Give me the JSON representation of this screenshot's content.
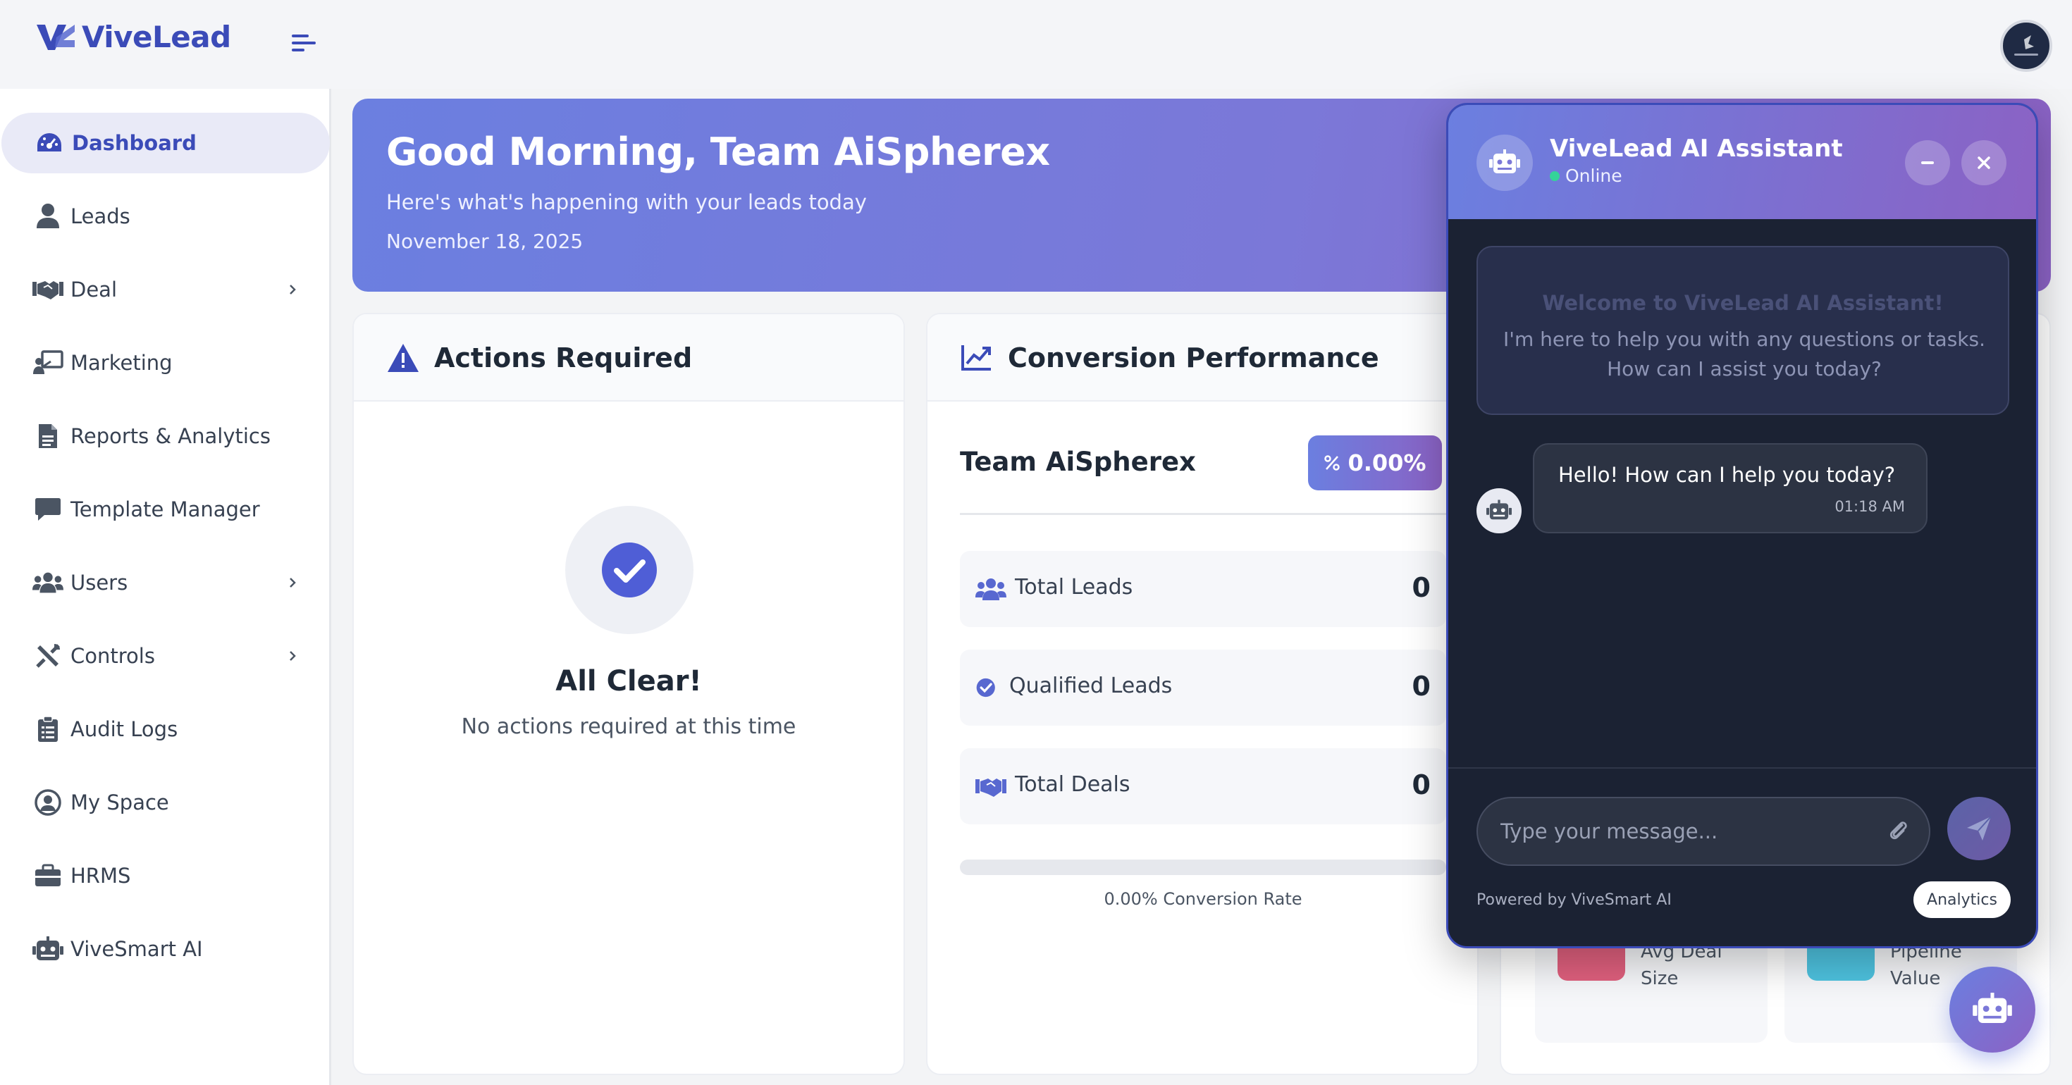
{
  "app": {
    "brand": "ViveLead"
  },
  "sidebar": {
    "items": [
      {
        "label": "Dashboard",
        "icon": "gauge-icon",
        "active": true
      },
      {
        "label": "Leads",
        "icon": "user-icon"
      },
      {
        "label": "Deal",
        "icon": "handshake-icon",
        "has_submenu": true
      },
      {
        "label": "Marketing",
        "icon": "presentation-icon"
      },
      {
        "label": "Reports & Analytics",
        "icon": "file-chart-icon"
      },
      {
        "label": "Template Manager",
        "icon": "message-icon"
      },
      {
        "label": "Users",
        "icon": "users-icon",
        "has_submenu": true
      },
      {
        "label": "Controls",
        "icon": "tools-icon",
        "has_submenu": true
      },
      {
        "label": "Audit Logs",
        "icon": "clipboard-list-icon"
      },
      {
        "label": "My Space",
        "icon": "user-circle-icon"
      },
      {
        "label": "HRMS",
        "icon": "briefcase-icon"
      },
      {
        "label": "ViveSmart AI",
        "icon": "robot-icon"
      }
    ]
  },
  "hero": {
    "greeting": "Good Morning, Team AiSpherex",
    "subtitle": "Here's what's happening with your leads today",
    "date": "November 18, 2025"
  },
  "actions": {
    "title": "Actions Required",
    "empty_title": "All Clear!",
    "empty_text": "No actions required at this time"
  },
  "conversion": {
    "title": "Conversion Performance",
    "team": "Team AiSpherex",
    "rate_badge": "0.00%",
    "progress": 0,
    "stats": [
      {
        "label": "Total Leads",
        "value": "0",
        "icon": "users-icon"
      },
      {
        "label": "Qualified Leads",
        "value": "0",
        "icon": "check-circle-icon"
      },
      {
        "label": "Total Deals",
        "value": "0",
        "icon": "handshake-icon"
      }
    ],
    "rate_text": "0.00% Conversion Rate"
  },
  "metrics": {
    "items": [
      {
        "label_line1": "Avg Deal",
        "label_line2": "Size",
        "color": "#e0607e"
      },
      {
        "label_line1": "Pipeline",
        "label_line2": "Value",
        "color": "#4ec3e0"
      }
    ]
  },
  "chat": {
    "title": "ViveLead AI Assistant",
    "status": "Online",
    "welcome_title": "Welcome to ViveLead AI Assistant!",
    "welcome_line1": "I'm here to help you with any questions or tasks.",
    "welcome_line2": "How can I assist you today?",
    "message_text": "Hello! How can I help you today?",
    "message_time": "01:18 AM",
    "input_placeholder": "Type your message...",
    "powered": "Powered by ViveSmart AI",
    "analytics_label": "Analytics"
  },
  "colors": {
    "brand": "#3b4bb8",
    "accent": "#6b7fe0",
    "accent_end": "#8b62c4",
    "chat_bg": "#1b2233"
  }
}
